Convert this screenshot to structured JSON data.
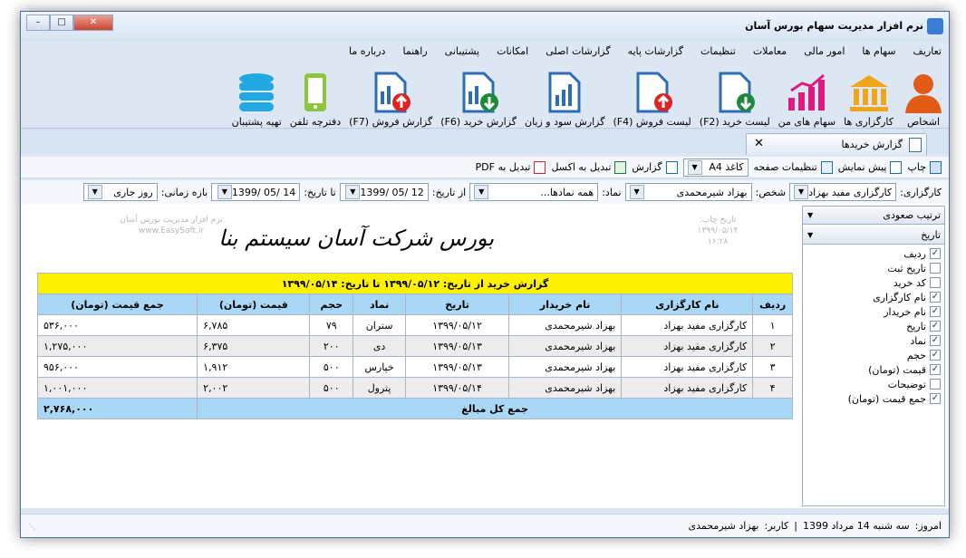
{
  "window": {
    "title": "نرم افزار مدیریت سهام بورس آسان",
    "colors": {
      "accent": "#3a7bd5",
      "close": "#c9452f"
    }
  },
  "menu": [
    "تعاریف",
    "سهام ها",
    "امور مالی",
    "معاملات",
    "تنظیمات",
    "گزارشات پایه",
    "گزارشات اصلی",
    "امکانات",
    "پشتیبانی",
    "راهنما",
    "درباره ما"
  ],
  "ribbon": [
    {
      "label": "اشخاص",
      "icon": "person-icon"
    },
    {
      "label": "کارگزاری ها",
      "icon": "bank-icon"
    },
    {
      "label": "سهام های من",
      "icon": "chart-icon"
    },
    {
      "label": "لیست خرید (F2)",
      "icon": "doc-down-icon"
    },
    {
      "label": "لیست فروش (F4)",
      "icon": "doc-up-icon"
    },
    {
      "label": "گزارش سود و زیان",
      "icon": "report-icon"
    },
    {
      "label": "گزارش خرید (F6)",
      "icon": "report-down-icon"
    },
    {
      "label": "گزارش فروش (F7)",
      "icon": "report-up-icon"
    },
    {
      "label": "دفترچه تلفن",
      "icon": "phone-icon"
    },
    {
      "label": "تهیه پشتیبان",
      "icon": "database-icon"
    }
  ],
  "tab": {
    "label": "گزارش خریدها"
  },
  "toolbar1": {
    "print": "چاپ",
    "preview": "پیش نمایش",
    "page_settings": "تنظیمات صفحه",
    "paper": "کاغذ A4",
    "report": "گزارش",
    "excel": "تبدیل به اکسل",
    "pdf": "تبدیل به PDF"
  },
  "toolbar2": {
    "broker_label": "کارگزاری:",
    "broker_value": "کارگزاری مفید بهزاد",
    "person_label": "شخص:",
    "person_value": "بهزاد شیرمحمدی",
    "symbol_label": "نماد:",
    "symbol_value": "همه نمادها...",
    "from_label": "از تاریخ:",
    "from_value": "1399/ 05/ 12",
    "to_label": "تا تاریخ:",
    "to_value": "1399/ 05/ 14",
    "period_label": "بازه زمانی:",
    "period_value": "روز جاری"
  },
  "report": {
    "company": "بورس شرکت آسان سیستم بنا",
    "left_top": [
      "نرم افزار مدیریت بورس آسان",
      "www.EasySoft.ir"
    ],
    "print_date": [
      "تاریخ چاپ:",
      "۱۳۹۹/۰۵/۱۴",
      "۱۶:۲۸"
    ],
    "title": "گزارش خرید از تاریخ: ۱۳۹۹/۰۵/۱۲ تا تاریخ: ۱۳۹۹/۰۵/۱۴",
    "headers": [
      "ردیف",
      "نام کارگزاری",
      "نام خریدار",
      "تاریخ",
      "نماد",
      "حجم",
      "قیمت (تومان)",
      "جمع قیمت (تومان)"
    ],
    "rows": [
      [
        "۱",
        "کارگزاری مفید بهزاد",
        "بهزاد شیرمحمدی",
        "۱۳۹۹/۰۵/۱۲",
        "ستران",
        "۷۹",
        "۶,۷۸۵",
        "۵۳۶,۰۰۰"
      ],
      [
        "۲",
        "کارگزاری مفید بهزاد",
        "بهزاد شیرمحمدی",
        "۱۳۹۹/۰۵/۱۳",
        "دی",
        "۲۰۰",
        "۶,۳۷۵",
        "۱,۲۷۵,۰۰۰"
      ],
      [
        "۳",
        "کارگزاری مفید بهزاد",
        "بهزاد شیرمحمدی",
        "۱۳۹۹/۰۵/۱۳",
        "خپارس",
        "۵۰۰",
        "۱,۹۱۲",
        "۹۵۶,۰۰۰"
      ],
      [
        "۴",
        "کارگزاری مفید بهزاد",
        "بهزاد شیرمحمدی",
        "۱۳۹۹/۰۵/۱۴",
        "پترول",
        "۵۰۰",
        "۲,۰۰۲",
        "۱,۰۰۱,۰۰۰"
      ]
    ],
    "total_label": "جمع کل مبالغ",
    "total_value": "۲,۷۶۸,۰۰۰"
  },
  "side": {
    "sort_label": "ترتیب صعودی",
    "date_label": "تاریخ",
    "columns": [
      {
        "label": "ردیف",
        "checked": true
      },
      {
        "label": "تاریخ ثبت",
        "checked": false
      },
      {
        "label": "کد خرید",
        "checked": false
      },
      {
        "label": "نام کارگزاری",
        "checked": true
      },
      {
        "label": "نام خریدار",
        "checked": true
      },
      {
        "label": "تاریخ",
        "checked": true
      },
      {
        "label": "نماد",
        "checked": true
      },
      {
        "label": "حجم",
        "checked": true
      },
      {
        "label": "قیمت (تومان)",
        "checked": true
      },
      {
        "label": "توضیحات",
        "checked": false
      },
      {
        "label": "جمع قیمت (تومان)",
        "checked": true
      }
    ]
  },
  "status": {
    "today_label": "امروز:",
    "today_value": "سه شنبه 14 مرداد 1399",
    "user_label": "کاربر:",
    "user_value": "بهزاد شیرمحمدی"
  }
}
